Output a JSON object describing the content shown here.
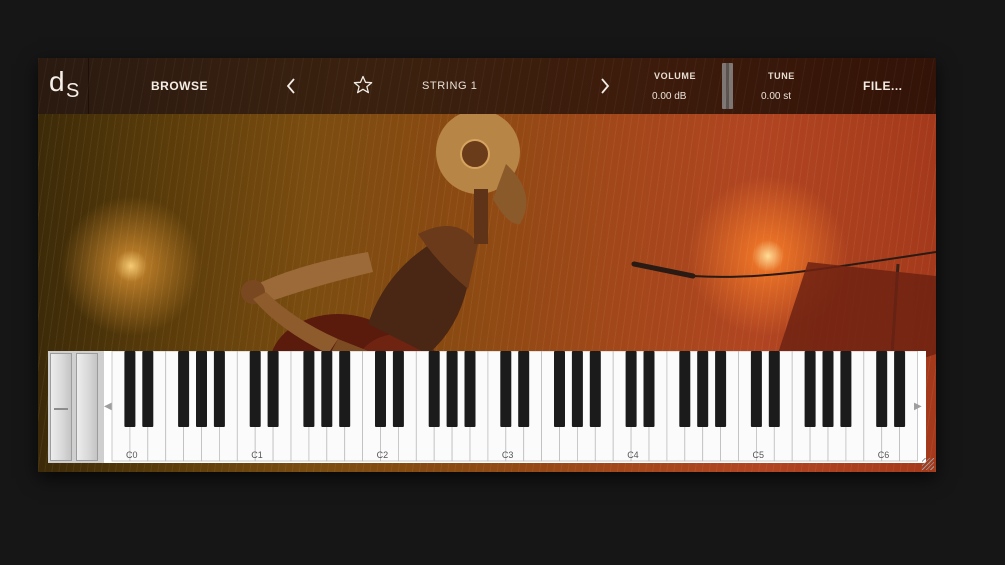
{
  "header": {
    "logo": {
      "letter1": "d",
      "letter2": "S"
    },
    "browse_label": "BROWSE",
    "preset_name": "STRING 1",
    "file_label": "FILE...",
    "prev_icon": "chevron-left-icon",
    "next_icon": "chevron-right-icon",
    "favorite_icon": "star-icon",
    "volume": {
      "label": "VOLUME",
      "value": "0.00 dB"
    },
    "tune": {
      "label": "TUNE",
      "value": "0.00 st"
    }
  },
  "artwork": {
    "description_icon": "robot-guitarist-artwork",
    "accent_colors": [
      "#7a4c10",
      "#b14522",
      "#ffd79a"
    ]
  },
  "keyboard": {
    "octave_labels": [
      "C0",
      "C1",
      "C2",
      "C3",
      "C4",
      "C5",
      "C6"
    ],
    "white_key_count": 45,
    "first_note": "C0",
    "octave_down_icon": "triangle-left-icon",
    "octave_up_icon": "triangle-right-icon"
  }
}
